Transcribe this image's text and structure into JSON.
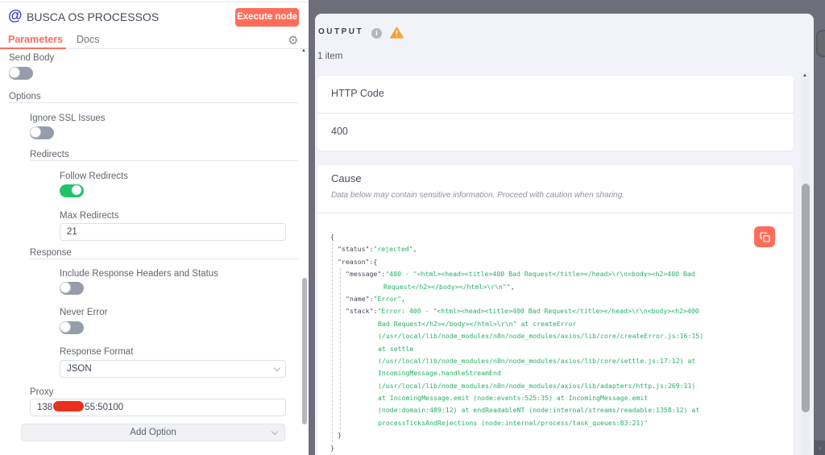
{
  "node": {
    "icon": "@",
    "title": "BUSCA OS PROCESSOS",
    "execute_button": "Execute node",
    "tabs": {
      "parameters": "Parameters",
      "docs": "Docs"
    }
  },
  "parameters": {
    "send_body": {
      "label": "Send Body",
      "value": false
    },
    "options_section": "Options",
    "ignore_ssl": {
      "label": "Ignore SSL Issues",
      "value": false
    },
    "redirects_section": "Redirects",
    "follow_redirects": {
      "label": "Follow Redirects",
      "value": true
    },
    "max_redirects": {
      "label": "Max Redirects",
      "value": "21"
    },
    "response_section": "Response",
    "include_response_headers": {
      "label": "Include Response Headers and Status",
      "value": false
    },
    "never_error": {
      "label": "Never Error",
      "value": false
    },
    "response_format": {
      "label": "Response Format",
      "value": "JSON"
    },
    "proxy": {
      "label": "Proxy",
      "value_prefix": "138",
      "value_suffix": "55:50100",
      "redacted": true
    },
    "add_option": "Add Option"
  },
  "output": {
    "title": "OUTPUT",
    "items_count": "1 item",
    "http_code": {
      "label": "HTTP Code",
      "value": "400"
    },
    "cause": {
      "title": "Cause",
      "warning_note": "Data below may contain sensitive information. Proceed with caution when sharing.",
      "error": {
        "status": "rejected",
        "message": "400 - \"<html><head><title>400 Bad Request</title></head>\\r\\n<body><h2>400 Bad Request</h2></body></html>\\r\\n\"",
        "name": "Error",
        "stack": "Error: 400 - \"<html><head><title>400 Bad Request</title></head>\\r\\n<body><h2>400 Bad Request</h2></body></html>\\r\\n\" at createError (/usr/local/lib/node_modules/n8n/node_modules/axios/lib/core/createError.js:16:15) at settle (/usr/local/lib/node_modules/n8n/node_modules/axios/lib/core/settle.js:17:12) at IncomingMessage.handleStreamEnd (/usr/local/lib/node_modules/n8n/node_modules/axios/lib/adapters/http.js:269:11) at IncomingMessage.emit (node:events:525:35) at IncomingMessage.emit (node:domain:489:12) at endReadableNT (node:internal/streams/readable:1358:12) at processTicksAndRejections (node:internal/process/task_queues:83:21)"
      },
      "json_lines": [
        {
          "p": 0,
          "s": [
            [
              "d",
              "{"
            ]
          ]
        },
        {
          "p": 9,
          "s": [
            [
              "d",
              "\"status\":"
            ],
            [
              "g",
              "\"rejected\""
            ],
            [
              "d",
              ","
            ]
          ]
        },
        {
          "p": 9,
          "s": [
            [
              "d",
              "\"reason\":{"
            ]
          ]
        },
        {
          "p": 19,
          "s": [
            [
              "d",
              "\"message\":"
            ],
            [
              "g",
              "\"400 - \"<html><head><title>400 Bad Request</title></head>\\r\\n<body><h2>400 Bad"
            ]
          ]
        },
        {
          "p": 66,
          "s": [
            [
              "g",
              "Request</h2></body></html>\\r\\n\"\""
            ],
            [
              "d",
              ","
            ]
          ]
        },
        {
          "p": 19,
          "s": [
            [
              "d",
              "\"name\":"
            ],
            [
              "g",
              "\"Error\""
            ],
            [
              "d",
              ","
            ]
          ]
        },
        {
          "p": 19,
          "s": [
            [
              "d",
              "\"stack\":"
            ],
            [
              "g",
              "\"Error: 400 - \"<html><head><title>400 Bad Request</title></head>\\r\\n<body><h2>400"
            ]
          ]
        },
        {
          "p": 59,
          "s": [
            [
              "g",
              "Bad Request</h2></body></html>\\r\\n\" at createError"
            ]
          ]
        },
        {
          "p": 59,
          "s": [
            [
              "g",
              "(/usr/local/lib/node_modules/n8n/node_modules/axios/lib/core/createError.js:16:15)"
            ]
          ]
        },
        {
          "p": 59,
          "s": [
            [
              "g",
              "at settle"
            ]
          ]
        },
        {
          "p": 59,
          "s": [
            [
              "g",
              "(/usr/local/lib/node_modules/n8n/node_modules/axios/lib/core/settle.js:17:12) at"
            ]
          ]
        },
        {
          "p": 59,
          "s": [
            [
              "g",
              "IncomingMessage.handleStreamEnd"
            ]
          ]
        },
        {
          "p": 59,
          "s": [
            [
              "g",
              "(/usr/local/lib/node_modules/n8n/node_modules/axios/lib/adapters/http.js:269:11)"
            ]
          ]
        },
        {
          "p": 59,
          "s": [
            [
              "g",
              "at IncomingMessage.emit (node:events:525:35) at IncomingMessage.emit"
            ]
          ]
        },
        {
          "p": 59,
          "s": [
            [
              "g",
              "(node:domain:489:12) at endReadableNT (node:internal/streams/readable:1358:12) at"
            ]
          ]
        },
        {
          "p": 59,
          "s": [
            [
              "g",
              "processTicksAndRejections (node:internal/process/task_queues:83:21)\""
            ]
          ]
        },
        {
          "p": 9,
          "s": [
            [
              "d",
              "}"
            ]
          ]
        },
        {
          "p": 0,
          "s": [
            [
              "d",
              "}"
            ]
          ]
        }
      ]
    }
  },
  "colors": {
    "accent": "#ff6d5a",
    "toggle_on": "#1ec46a",
    "json_string": "#27b263",
    "warning": "#f2a23c",
    "redaction": "#e8321f"
  }
}
